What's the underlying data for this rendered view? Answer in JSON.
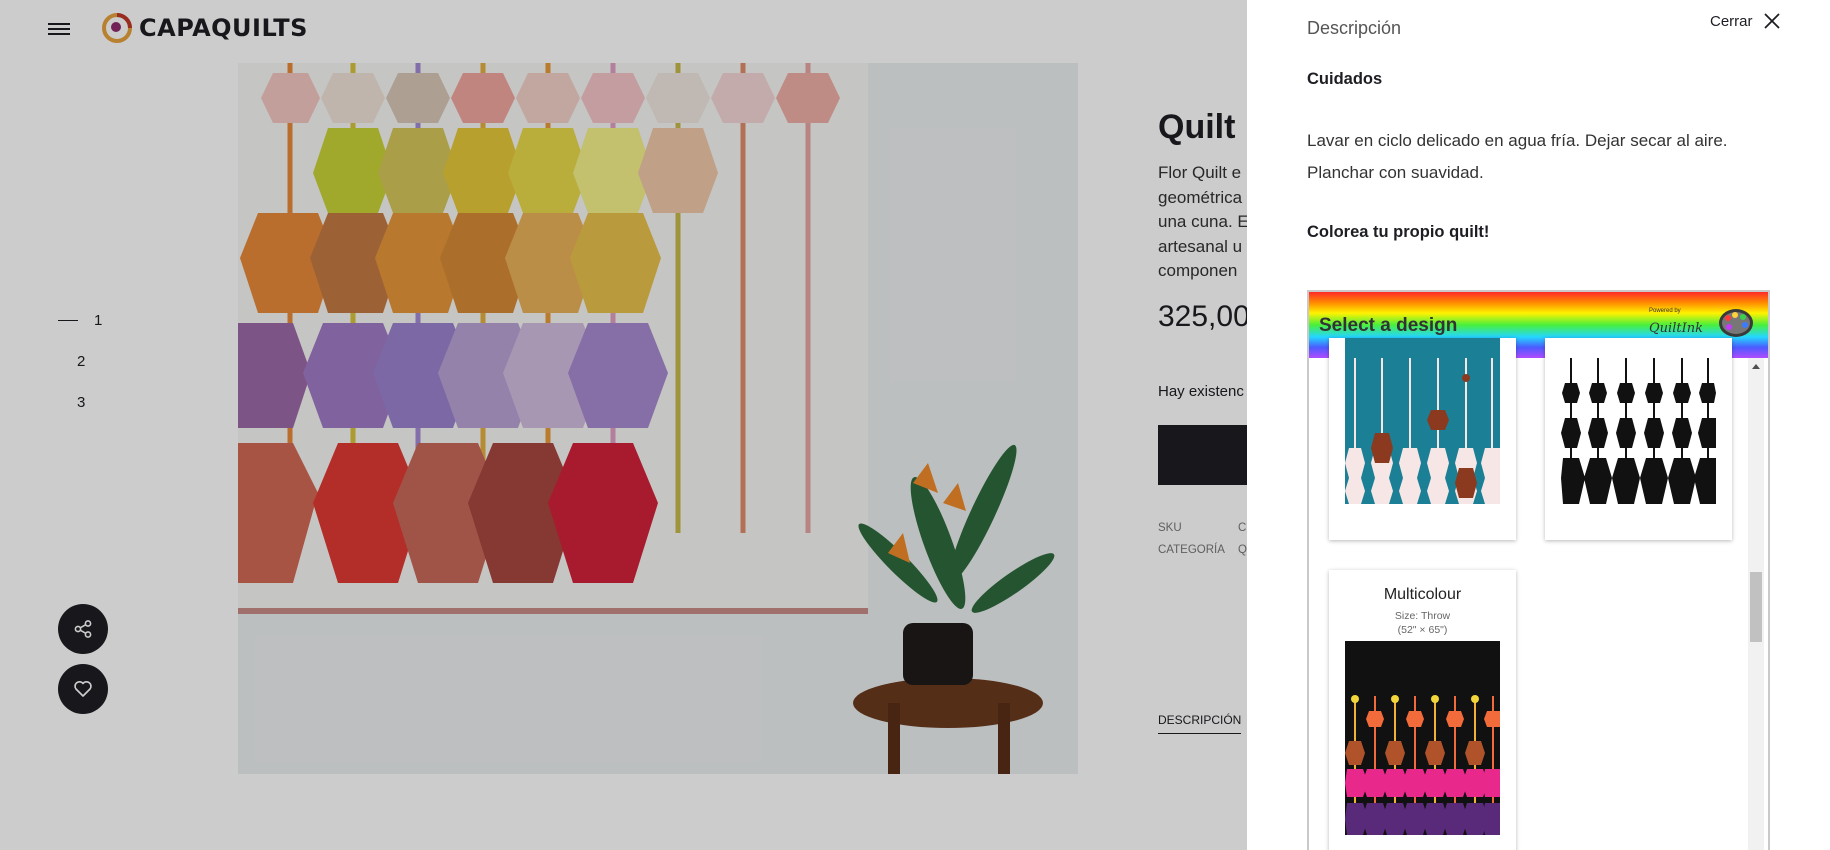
{
  "header": {
    "brand": "CAPAQUILTS",
    "menu_icon": "hamburger-menu-icon",
    "brand_color": "#c0392b"
  },
  "gallery": {
    "pages": [
      "1",
      "2",
      "3"
    ],
    "active": "1"
  },
  "product": {
    "title": "Quilt",
    "description": "Flor Quilt e geométrica una cuna. E artesanal u componen",
    "description_lines": [
      "Flor Quilt e",
      "geométrica",
      "una cuna. E",
      "artesanal u",
      "componen"
    ],
    "price": "325,00",
    "stock_label": "Hay existenc",
    "sku_label": "SKU",
    "sku_value": "C",
    "category_label": "CATEGORÍA",
    "category_value": "Q",
    "tab_label": "DESCRIPCIÓN"
  },
  "actions": {
    "share_icon": "share-icon",
    "wishlist_icon": "heart-icon"
  },
  "panel": {
    "title": "Descripción",
    "close_label": "Cerrar",
    "care_title": "Cuidados",
    "care_text": "Lavar en ciclo delicado en agua fría. Dejar secar al aire. Planchar con suavidad.",
    "color_title": "Colorea tu propio quilt!"
  },
  "designer": {
    "header": "Select a design",
    "powered_by": "Powered by",
    "brand": "QuiltInk",
    "cards": [
      {
        "title": "",
        "size": "",
        "dims": ""
      },
      {
        "title": "",
        "size": "",
        "dims": ""
      },
      {
        "title": "Multicolour",
        "size": "Size: Throw",
        "dims": "(52\" × 65\")"
      }
    ]
  }
}
